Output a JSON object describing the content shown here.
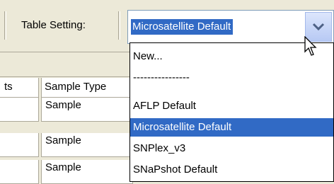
{
  "toolbar": {
    "table_setting_label": "Table Setting:",
    "selected_value": "Microsatellite Default"
  },
  "table": {
    "headers": [
      "ts",
      "Sample Type"
    ],
    "rows": [
      {
        "sample_type": "Sample"
      },
      {
        "sample_type": "Sample"
      },
      {
        "sample_type": "Sample"
      }
    ]
  },
  "dropdown": {
    "items": [
      {
        "label": "New...",
        "selected": false
      },
      {
        "label": "----------------",
        "selected": false
      },
      {
        "label": "AFLP Default",
        "selected": false
      },
      {
        "label": "Microsatellite Default",
        "selected": true
      },
      {
        "label": "SNPlex_v3",
        "selected": false
      },
      {
        "label": "SNaPshot Default",
        "selected": false
      }
    ]
  },
  "colors": {
    "selection": "#316ac5",
    "chrome": "#ece9d8",
    "combo_border": "#7f9db9"
  },
  "icons": [
    "chevron-down-icon",
    "mouse-cursor-icon"
  ]
}
